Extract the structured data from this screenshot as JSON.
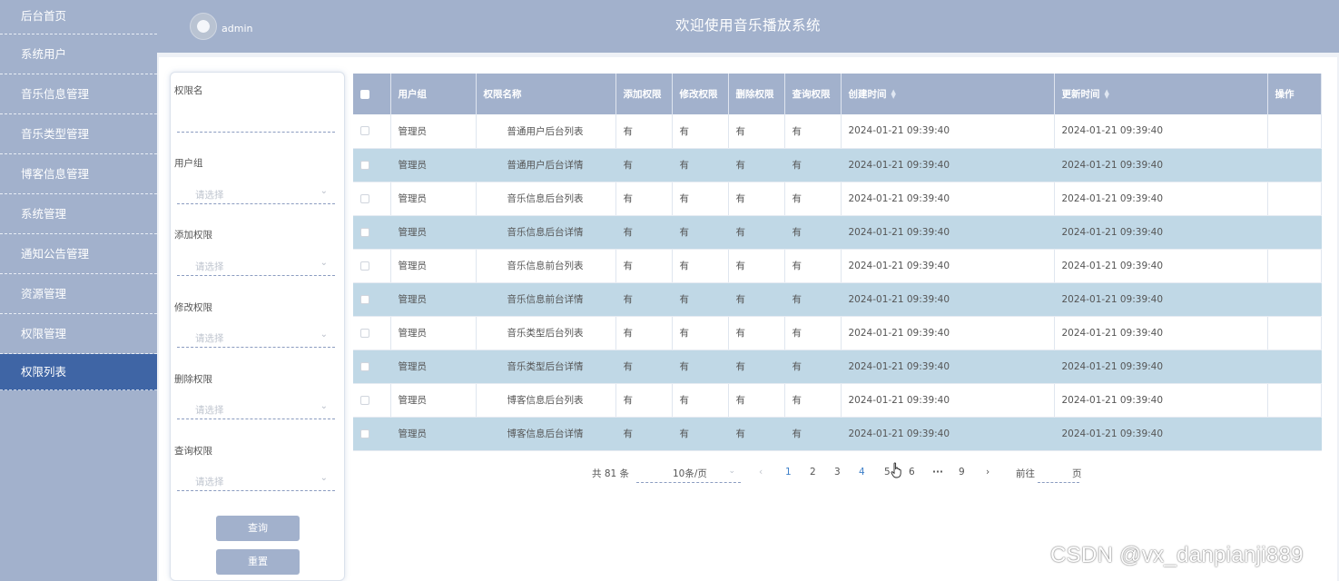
{
  "header": {
    "admin": "admin",
    "title": "欢迎使用音乐播放系统"
  },
  "sidebar": {
    "items": [
      {
        "label": "后台首页"
      },
      {
        "label": "系统用户"
      },
      {
        "label": "音乐信息管理"
      },
      {
        "label": "音乐类型管理"
      },
      {
        "label": "博客信息管理"
      },
      {
        "label": "系统管理"
      },
      {
        "label": "通知公告管理"
      },
      {
        "label": "资源管理"
      },
      {
        "label": "权限管理"
      },
      {
        "label": "权限列表",
        "active": true
      }
    ]
  },
  "filter": {
    "perm_name_label": "权限名",
    "user_group_label": "用户组",
    "add_label": "添加权限",
    "edit_label": "修改权限",
    "delete_label": "删除权限",
    "query_label": "查询权限",
    "placeholder": "请选择",
    "search_btn": "查询",
    "reset_btn": "重置"
  },
  "table": {
    "headers": [
      "用户组",
      "权限名称",
      "添加权限",
      "修改权限",
      "删除权限",
      "查询权限",
      "创建时间",
      "更新时间",
      "操作"
    ],
    "rows": [
      {
        "group": "管理员",
        "name": "普通用户后台列表",
        "add": "有",
        "edit": "有",
        "del": "有",
        "query": "有",
        "created": "2024-01-21 09:39:40",
        "updated": "2024-01-21 09:39:40"
      },
      {
        "group": "管理员",
        "name": "普通用户后台详情",
        "add": "有",
        "edit": "有",
        "del": "有",
        "query": "有",
        "created": "2024-01-21 09:39:40",
        "updated": "2024-01-21 09:39:40"
      },
      {
        "group": "管理员",
        "name": "音乐信息后台列表",
        "add": "有",
        "edit": "有",
        "del": "有",
        "query": "有",
        "created": "2024-01-21 09:39:40",
        "updated": "2024-01-21 09:39:40"
      },
      {
        "group": "管理员",
        "name": "音乐信息后台详情",
        "add": "有",
        "edit": "有",
        "del": "有",
        "query": "有",
        "created": "2024-01-21 09:39:40",
        "updated": "2024-01-21 09:39:40"
      },
      {
        "group": "管理员",
        "name": "音乐信息前台列表",
        "add": "有",
        "edit": "有",
        "del": "有",
        "query": "有",
        "created": "2024-01-21 09:39:40",
        "updated": "2024-01-21 09:39:40"
      },
      {
        "group": "管理员",
        "name": "音乐信息前台详情",
        "add": "有",
        "edit": "有",
        "del": "有",
        "query": "有",
        "created": "2024-01-21 09:39:40",
        "updated": "2024-01-21 09:39:40"
      },
      {
        "group": "管理员",
        "name": "音乐类型后台列表",
        "add": "有",
        "edit": "有",
        "del": "有",
        "query": "有",
        "created": "2024-01-21 09:39:40",
        "updated": "2024-01-21 09:39:40"
      },
      {
        "group": "管理员",
        "name": "音乐类型后台详情",
        "add": "有",
        "edit": "有",
        "del": "有",
        "query": "有",
        "created": "2024-01-21 09:39:40",
        "updated": "2024-01-21 09:39:40"
      },
      {
        "group": "管理员",
        "name": "博客信息后台列表",
        "add": "有",
        "edit": "有",
        "del": "有",
        "query": "有",
        "created": "2024-01-21 09:39:40",
        "updated": "2024-01-21 09:39:40"
      },
      {
        "group": "管理员",
        "name": "博客信息后台详情",
        "add": "有",
        "edit": "有",
        "del": "有",
        "query": "有",
        "created": "2024-01-21 09:39:40",
        "updated": "2024-01-21 09:39:40"
      }
    ]
  },
  "pagination": {
    "total": "共 81 条",
    "page_size": "10条/页",
    "pages": [
      "1",
      "2",
      "3",
      "4",
      "5",
      "6",
      "···",
      "9"
    ],
    "current": "1",
    "goto_label": "前往",
    "page_unit": "页"
  },
  "watermark": "CSDN @vx_danpianji889"
}
